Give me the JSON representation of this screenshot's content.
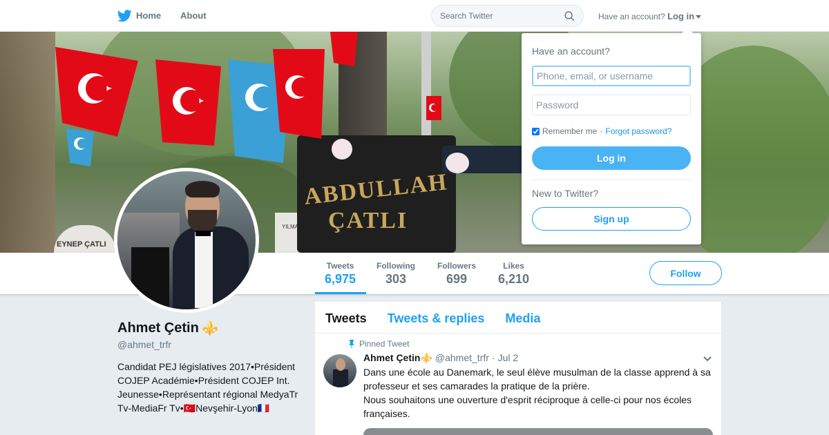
{
  "nav": {
    "home_label": "Home",
    "about_label": "About",
    "search_placeholder": "Search Twitter",
    "have_account_text": "Have an account?",
    "login_label": "Log in"
  },
  "banner": {
    "stone_line1": "ABDULLAH",
    "stone_line2": "ÇATLI",
    "grave_text": "EYNEP ÇATLI",
    "grave2_text": "YILMA RUHUN"
  },
  "stats": [
    {
      "label": "Tweets",
      "value": "6,975",
      "active": true
    },
    {
      "label": "Following",
      "value": "303"
    },
    {
      "label": "Followers",
      "value": "699"
    },
    {
      "label": "Likes",
      "value": "6,210"
    }
  ],
  "follow_label": "Follow",
  "profile": {
    "name": "Ahmet Çetin",
    "badge_emoji": "⚜️",
    "handle": "@ahmet_trfr",
    "bio": "Candidat PEJ législatives 2017•Président COJEP Académie•Président COJEP Int. Jeunesse•Représentant régional MedyaTr Tv-MediaFr Tv•🇹🇷Nevşehir-Lyon🇫🇷"
  },
  "timeline": {
    "tabs": [
      "Tweets",
      "Tweets & replies",
      "Media"
    ],
    "pinned_label": "Pinned Tweet",
    "tweet": {
      "name": "Ahmet Çetin⚜️",
      "handle": "@ahmet_trfr",
      "dot": "·",
      "date": "Jul 2",
      "text_line1": "Dans une école au Danemark, le seul élève musulman de la classe apprend à sa professeur et ses camarades la pratique de la prière.",
      "text_line2": "Nous souhaitons une ouverture d'esprit réciproque à celle-ci pour nos écoles françaises."
    }
  },
  "login_dropdown": {
    "title": "Have an account?",
    "username_placeholder": "Phone, email, or username",
    "password_placeholder": "Password",
    "remember_label": "Remember me",
    "separator": "·",
    "forgot_label": "Forgot password?",
    "login_button": "Log in",
    "new_label": "New to Twitter?",
    "signup_button": "Sign up"
  },
  "colors": {
    "brand": "#1da1f2",
    "background": "#e6ecf0"
  },
  "icons": [
    "twitter-bird-icon",
    "search-icon",
    "caret-down-icon",
    "pin-icon",
    "chevron-down-icon"
  ]
}
